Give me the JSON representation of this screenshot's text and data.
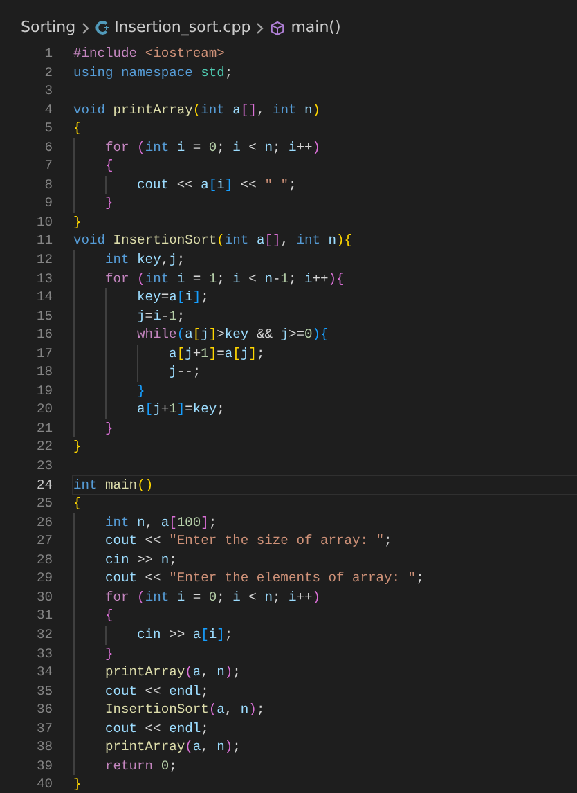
{
  "breadcrumb": {
    "folder": "Sorting",
    "file": "Insertion_sort.cpp",
    "symbol": "main()"
  },
  "lines": [
    {
      "number": "1",
      "selected": false,
      "tokens": [
        {
          "text": "#include",
          "kind": "ctrl"
        },
        {
          "text": " <iostream>",
          "kind": "str"
        }
      ]
    },
    {
      "number": "2",
      "selected": false,
      "tokens": [
        {
          "text": "using",
          "kind": "kw"
        },
        {
          "text": " namespace",
          "kind": "kw"
        },
        {
          "text": " std",
          "kind": "type"
        },
        {
          "text": ";",
          "kind": "p"
        }
      ]
    },
    {
      "number": "3",
      "selected": false
    },
    {
      "number": "4",
      "selected": false,
      "tokens": [
        {
          "text": "void",
          "kind": "kw"
        },
        {
          "text": " printArray",
          "kind": "fn"
        },
        {
          "text": "(",
          "kind": "b1"
        },
        {
          "text": "int",
          "kind": "kw"
        },
        {
          "text": " a",
          "kind": "var"
        },
        {
          "text": "[]",
          "kind": "b2"
        },
        {
          "text": ",",
          "kind": "p"
        },
        {
          "text": " int",
          "kind": "kw"
        },
        {
          "text": " n",
          "kind": "var"
        },
        {
          "text": ")",
          "kind": "b1"
        }
      ]
    },
    {
      "number": "5",
      "selected": false,
      "tokens": [
        {
          "text": "{",
          "kind": "b1"
        }
      ]
    },
    {
      "number": "6",
      "selected": false,
      "tokens": [
        {
          "text": "    for",
          "kind": "ctrl"
        },
        {
          "text": " (",
          "kind": "b2"
        },
        {
          "text": "int",
          "kind": "kw"
        },
        {
          "text": " i",
          "kind": "var"
        },
        {
          "text": " =",
          "kind": "p"
        },
        {
          "text": " 0",
          "kind": "num"
        },
        {
          "text": ";",
          "kind": "p"
        },
        {
          "text": " i",
          "kind": "var"
        },
        {
          "text": " <",
          "kind": "p"
        },
        {
          "text": " n",
          "kind": "var"
        },
        {
          "text": ";",
          "kind": "p"
        },
        {
          "text": " i",
          "kind": "var"
        },
        {
          "text": "++",
          "kind": "p"
        },
        {
          "text": ")",
          "kind": "b2"
        }
      ]
    },
    {
      "number": "7",
      "selected": false,
      "tokens": [
        {
          "text": "    {",
          "kind": "b2"
        }
      ]
    },
    {
      "number": "8",
      "selected": false,
      "tokens": [
        {
          "text": "        cout",
          "kind": "var"
        },
        {
          "text": " <<",
          "kind": "p"
        },
        {
          "text": " a",
          "kind": "var"
        },
        {
          "text": "[",
          "kind": "b3"
        },
        {
          "text": "i",
          "kind": "var"
        },
        {
          "text": "]",
          "kind": "b3"
        },
        {
          "text": " <<",
          "kind": "p"
        },
        {
          "text": " \" \"",
          "kind": "str"
        },
        {
          "text": ";",
          "kind": "p"
        }
      ]
    },
    {
      "number": "9",
      "selected": false,
      "tokens": [
        {
          "text": "    }",
          "kind": "b2"
        }
      ]
    },
    {
      "number": "10",
      "selected": false,
      "tokens": [
        {
          "text": "}",
          "kind": "b1"
        }
      ]
    },
    {
      "number": "11",
      "selected": false,
      "tokens": [
        {
          "text": "void",
          "kind": "kw"
        },
        {
          "text": " InsertionSort",
          "kind": "fn"
        },
        {
          "text": "(",
          "kind": "b1"
        },
        {
          "text": "int",
          "kind": "kw"
        },
        {
          "text": " a",
          "kind": "var"
        },
        {
          "text": "[]",
          "kind": "b2"
        },
        {
          "text": ",",
          "kind": "p"
        },
        {
          "text": " int",
          "kind": "kw"
        },
        {
          "text": " n",
          "kind": "var"
        },
        {
          "text": "){",
          "kind": "b1"
        }
      ]
    },
    {
      "number": "12",
      "selected": false,
      "tokens": [
        {
          "text": "    int",
          "kind": "kw"
        },
        {
          "text": " key",
          "kind": "var"
        },
        {
          "text": ",",
          "kind": "p"
        },
        {
          "text": "j",
          "kind": "var"
        },
        {
          "text": ";",
          "kind": "p"
        }
      ]
    },
    {
      "number": "13",
      "selected": false,
      "tokens": [
        {
          "text": "    for",
          "kind": "ctrl"
        },
        {
          "text": " (",
          "kind": "b2"
        },
        {
          "text": "int",
          "kind": "kw"
        },
        {
          "text": " i",
          "kind": "var"
        },
        {
          "text": " =",
          "kind": "p"
        },
        {
          "text": " 1",
          "kind": "num"
        },
        {
          "text": ";",
          "kind": "p"
        },
        {
          "text": " i",
          "kind": "var"
        },
        {
          "text": " <",
          "kind": "p"
        },
        {
          "text": " n",
          "kind": "var"
        },
        {
          "text": "-",
          "kind": "p"
        },
        {
          "text": "1",
          "kind": "num"
        },
        {
          "text": ";",
          "kind": "p"
        },
        {
          "text": " i",
          "kind": "var"
        },
        {
          "text": "++",
          "kind": "p"
        },
        {
          "text": "){",
          "kind": "b2"
        }
      ]
    },
    {
      "number": "14",
      "selected": false,
      "tokens": [
        {
          "text": "        key",
          "kind": "var"
        },
        {
          "text": "=",
          "kind": "p"
        },
        {
          "text": "a",
          "kind": "var"
        },
        {
          "text": "[",
          "kind": "b3"
        },
        {
          "text": "i",
          "kind": "var"
        },
        {
          "text": "]",
          "kind": "b3"
        },
        {
          "text": ";",
          "kind": "p"
        }
      ]
    },
    {
      "number": "15",
      "selected": false,
      "tokens": [
        {
          "text": "        j",
          "kind": "var"
        },
        {
          "text": "=",
          "kind": "p"
        },
        {
          "text": "i",
          "kind": "var"
        },
        {
          "text": "-",
          "kind": "p"
        },
        {
          "text": "1",
          "kind": "num"
        },
        {
          "text": ";",
          "kind": "p"
        }
      ]
    },
    {
      "number": "16",
      "selected": false,
      "tokens": [
        {
          "text": "        while",
          "kind": "ctrl"
        },
        {
          "text": "(",
          "kind": "b3"
        },
        {
          "text": "a",
          "kind": "var"
        },
        {
          "text": "[",
          "kind": "b1"
        },
        {
          "text": "j",
          "kind": "var"
        },
        {
          "text": "]",
          "kind": "b1"
        },
        {
          "text": ">",
          "kind": "p"
        },
        {
          "text": "key",
          "kind": "var"
        },
        {
          "text": " &&",
          "kind": "p"
        },
        {
          "text": " j",
          "kind": "var"
        },
        {
          "text": ">=",
          "kind": "p"
        },
        {
          "text": "0",
          "kind": "num"
        },
        {
          "text": "){",
          "kind": "b3"
        }
      ]
    },
    {
      "number": "17",
      "selected": false,
      "tokens": [
        {
          "text": "            a",
          "kind": "var"
        },
        {
          "text": "[",
          "kind": "b1"
        },
        {
          "text": "j",
          "kind": "var"
        },
        {
          "text": "+",
          "kind": "p"
        },
        {
          "text": "1",
          "kind": "num"
        },
        {
          "text": "]",
          "kind": "b1"
        },
        {
          "text": "=",
          "kind": "p"
        },
        {
          "text": "a",
          "kind": "var"
        },
        {
          "text": "[",
          "kind": "b1"
        },
        {
          "text": "j",
          "kind": "var"
        },
        {
          "text": "]",
          "kind": "b1"
        },
        {
          "text": ";",
          "kind": "p"
        }
      ]
    },
    {
      "number": "18",
      "selected": false,
      "tokens": [
        {
          "text": "            j",
          "kind": "var"
        },
        {
          "text": "--;",
          "kind": "p"
        }
      ]
    },
    {
      "number": "19",
      "selected": false,
      "tokens": [
        {
          "text": "        }",
          "kind": "b3"
        }
      ]
    },
    {
      "number": "20",
      "selected": false,
      "tokens": [
        {
          "text": "        a",
          "kind": "var"
        },
        {
          "text": "[",
          "kind": "b3"
        },
        {
          "text": "j",
          "kind": "var"
        },
        {
          "text": "+",
          "kind": "p"
        },
        {
          "text": "1",
          "kind": "num"
        },
        {
          "text": "]",
          "kind": "b3"
        },
        {
          "text": "=",
          "kind": "p"
        },
        {
          "text": "key",
          "kind": "var"
        },
        {
          "text": ";",
          "kind": "p"
        }
      ]
    },
    {
      "number": "21",
      "selected": false,
      "tokens": [
        {
          "text": "    }",
          "kind": "b2"
        }
      ]
    },
    {
      "number": "22",
      "selected": false,
      "tokens": [
        {
          "text": "}",
          "kind": "b1"
        }
      ]
    },
    {
      "number": "23",
      "selected": false
    },
    {
      "number": "24",
      "selected": true,
      "tokens": [
        {
          "text": "int",
          "kind": "kw"
        },
        {
          "text": " main",
          "kind": "fn"
        },
        {
          "text": "()",
          "kind": "b1"
        }
      ]
    },
    {
      "number": "25",
      "selected": false,
      "tokens": [
        {
          "text": "{",
          "kind": "b1"
        }
      ]
    },
    {
      "number": "26",
      "selected": false,
      "tokens": [
        {
          "text": "    int",
          "kind": "kw"
        },
        {
          "text": " n",
          "kind": "var"
        },
        {
          "text": ",",
          "kind": "p"
        },
        {
          "text": " a",
          "kind": "var"
        },
        {
          "text": "[",
          "kind": "b2"
        },
        {
          "text": "100",
          "kind": "num"
        },
        {
          "text": "]",
          "kind": "b2"
        },
        {
          "text": ";",
          "kind": "p"
        }
      ]
    },
    {
      "number": "27",
      "selected": false,
      "tokens": [
        {
          "text": "    cout",
          "kind": "var"
        },
        {
          "text": " <<",
          "kind": "p"
        },
        {
          "text": " \"Enter the size of array: \"",
          "kind": "str"
        },
        {
          "text": ";",
          "kind": "p"
        }
      ]
    },
    {
      "number": "28",
      "selected": false,
      "tokens": [
        {
          "text": "    cin",
          "kind": "var"
        },
        {
          "text": " >>",
          "kind": "p"
        },
        {
          "text": " n",
          "kind": "var"
        },
        {
          "text": ";",
          "kind": "p"
        }
      ]
    },
    {
      "number": "29",
      "selected": false,
      "tokens": [
        {
          "text": "    cout",
          "kind": "var"
        },
        {
          "text": " <<",
          "kind": "p"
        },
        {
          "text": " \"Enter the elements of array: \"",
          "kind": "str"
        },
        {
          "text": ";",
          "kind": "p"
        }
      ]
    },
    {
      "number": "30",
      "selected": false,
      "tokens": [
        {
          "text": "    for",
          "kind": "ctrl"
        },
        {
          "text": " (",
          "kind": "b2"
        },
        {
          "text": "int",
          "kind": "kw"
        },
        {
          "text": " i",
          "kind": "var"
        },
        {
          "text": " =",
          "kind": "p"
        },
        {
          "text": " 0",
          "kind": "num"
        },
        {
          "text": ";",
          "kind": "p"
        },
        {
          "text": " i",
          "kind": "var"
        },
        {
          "text": " <",
          "kind": "p"
        },
        {
          "text": " n",
          "kind": "var"
        },
        {
          "text": ";",
          "kind": "p"
        },
        {
          "text": " i",
          "kind": "var"
        },
        {
          "text": "++",
          "kind": "p"
        },
        {
          "text": ")",
          "kind": "b2"
        }
      ]
    },
    {
      "number": "31",
      "selected": false,
      "tokens": [
        {
          "text": "    {",
          "kind": "b2"
        }
      ]
    },
    {
      "number": "32",
      "selected": false,
      "tokens": [
        {
          "text": "        cin",
          "kind": "var"
        },
        {
          "text": " >>",
          "kind": "p"
        },
        {
          "text": " a",
          "kind": "var"
        },
        {
          "text": "[",
          "kind": "b3"
        },
        {
          "text": "i",
          "kind": "var"
        },
        {
          "text": "]",
          "kind": "b3"
        },
        {
          "text": ";",
          "kind": "p"
        }
      ]
    },
    {
      "number": "33",
      "selected": false,
      "tokens": [
        {
          "text": "    }",
          "kind": "b2"
        }
      ]
    },
    {
      "number": "34",
      "selected": false,
      "tokens": [
        {
          "text": "    printArray",
          "kind": "fn"
        },
        {
          "text": "(",
          "kind": "b2"
        },
        {
          "text": "a",
          "kind": "var"
        },
        {
          "text": ",",
          "kind": "p"
        },
        {
          "text": " n",
          "kind": "var"
        },
        {
          "text": ")",
          "kind": "b2"
        },
        {
          "text": ";",
          "kind": "p"
        }
      ]
    },
    {
      "number": "35",
      "selected": false,
      "tokens": [
        {
          "text": "    cout",
          "kind": "var"
        },
        {
          "text": " <<",
          "kind": "p"
        },
        {
          "text": " endl",
          "kind": "var"
        },
        {
          "text": ";",
          "kind": "p"
        }
      ]
    },
    {
      "number": "36",
      "selected": false,
      "tokens": [
        {
          "text": "    InsertionSort",
          "kind": "fn"
        },
        {
          "text": "(",
          "kind": "b2"
        },
        {
          "text": "a",
          "kind": "var"
        },
        {
          "text": ",",
          "kind": "p"
        },
        {
          "text": " n",
          "kind": "var"
        },
        {
          "text": ")",
          "kind": "b2"
        },
        {
          "text": ";",
          "kind": "p"
        }
      ]
    },
    {
      "number": "37",
      "selected": false,
      "tokens": [
        {
          "text": "    cout",
          "kind": "var"
        },
        {
          "text": " <<",
          "kind": "p"
        },
        {
          "text": " endl",
          "kind": "var"
        },
        {
          "text": ";",
          "kind": "p"
        }
      ]
    },
    {
      "number": "38",
      "selected": false,
      "tokens": [
        {
          "text": "    printArray",
          "kind": "fn"
        },
        {
          "text": "(",
          "kind": "b2"
        },
        {
          "text": "a",
          "kind": "var"
        },
        {
          "text": ",",
          "kind": "p"
        },
        {
          "text": " n",
          "kind": "var"
        },
        {
          "text": ")",
          "kind": "b2"
        },
        {
          "text": ";",
          "kind": "p"
        }
      ]
    },
    {
      "number": "39",
      "selected": false,
      "tokens": [
        {
          "text": "    return",
          "kind": "ctrl"
        },
        {
          "text": " 0",
          "kind": "num"
        },
        {
          "text": ";",
          "kind": "p"
        }
      ]
    },
    {
      "number": "40",
      "selected": false,
      "tokens": [
        {
          "text": "}",
          "kind": "b1"
        }
      ]
    }
  ]
}
